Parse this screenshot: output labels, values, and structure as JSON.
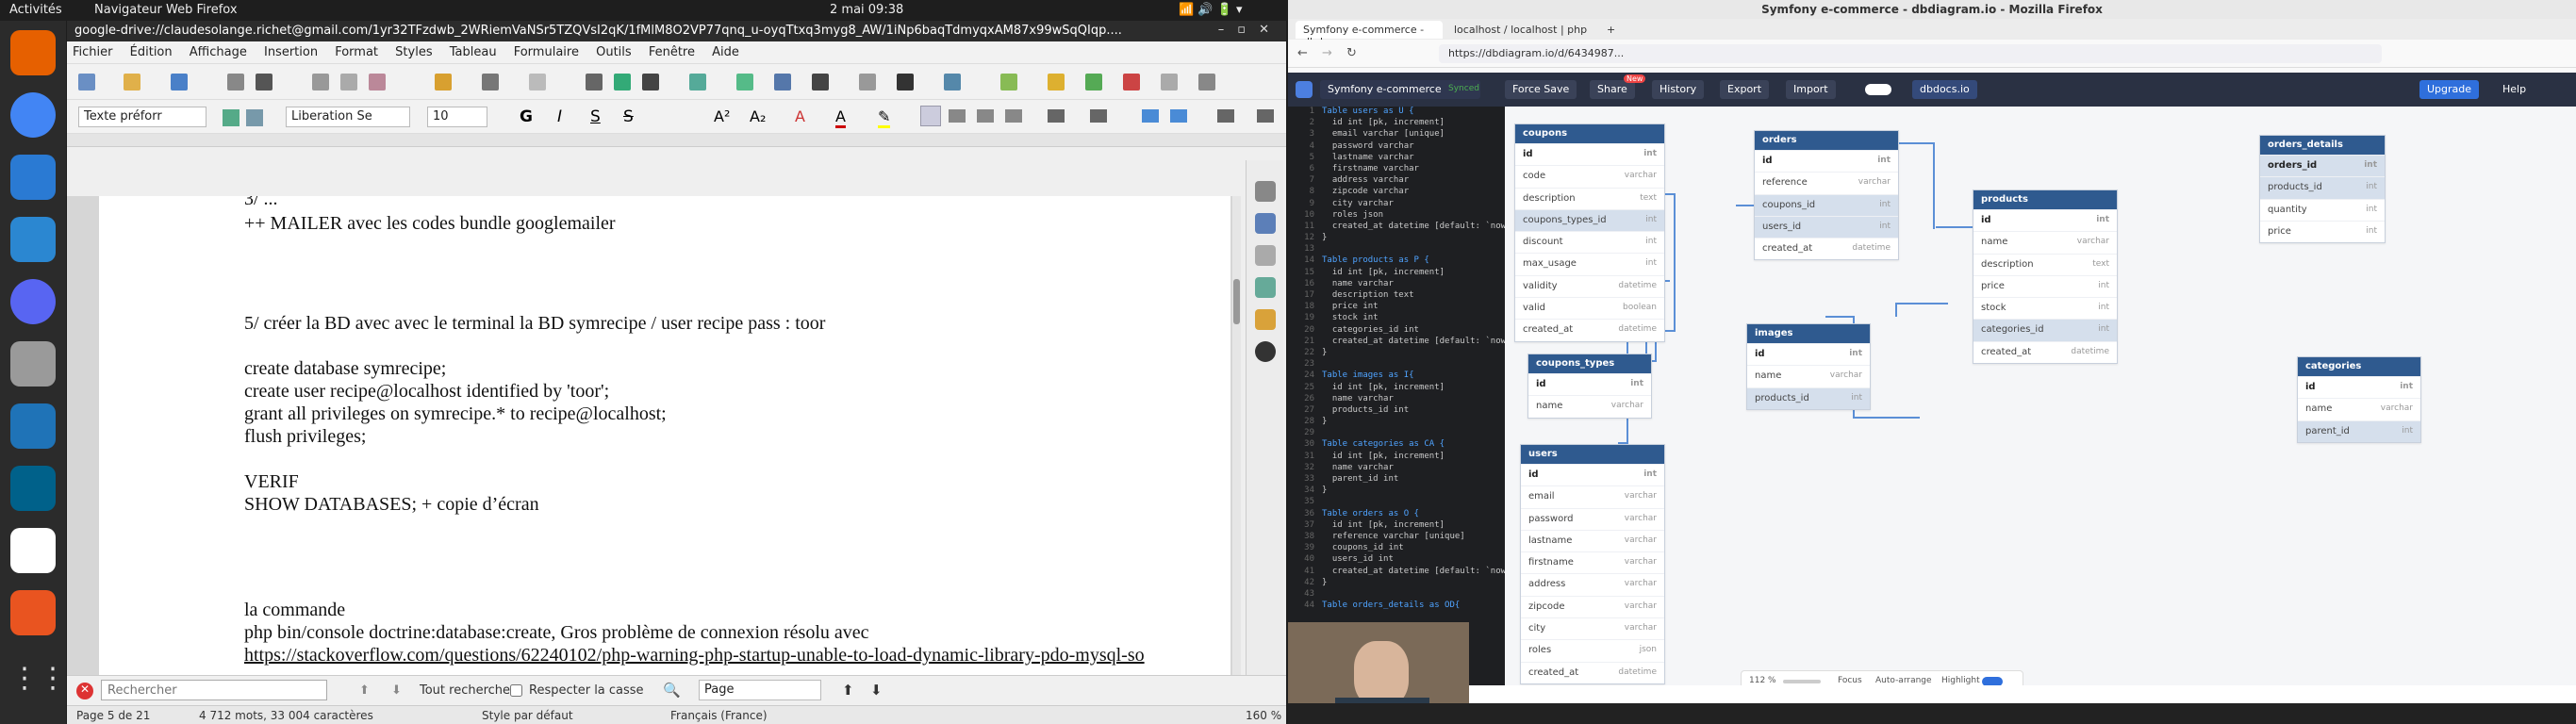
{
  "system": {
    "activities": "Activités",
    "app_menu": "Navigateur Web Firefox",
    "clock": "2 mai  09:38"
  },
  "writer": {
    "title": "google-drive://claudesolange.richet@gmail.com/1yr32TFzdwb_2WRiemVaNSr5TZQVsI2qK/1fMlM8O2VP77qnq_u-oyqTtxq3myg8_AW/1iNp6baqTdmyqxAM87x99wSqQIqp....",
    "menu": [
      "Fichier",
      "Édition",
      "Affichage",
      "Insertion",
      "Format",
      "Styles",
      "Tableau",
      "Formulaire",
      "Outils",
      "Fenêtre",
      "Aide"
    ],
    "para_style": "Texte préforr",
    "font_name": "Liberation Se",
    "font_size": "10",
    "lines": [
      {
        "text": "3/ ..."
      },
      {
        "text": "++ MAILER avec les codes   bundle googlemailer"
      },
      {
        "text": "5/ créer la BD avec avec le terminal la BD symrecipe / user recipe pass : toor"
      },
      {
        "text": "create database symrecipe;"
      },
      {
        "text": "create user recipe@localhost identified by 'toor';"
      },
      {
        "text": "grant all privileges on symrecipe.* to recipe@localhost;"
      },
      {
        "text": "flush privileges;"
      },
      {
        "text": "VERIF"
      },
      {
        "text": "SHOW DATABASES; + copie d’écran"
      },
      {
        "text": " la commande"
      },
      {
        "text": " php bin/console doctrine:database:create, Gros problème de connexion résolu avec"
      },
      {
        "text": "https://stackoverflow.com/questions/62240102/php-warning-php-startup-unable-to-load-dynamic-library-pdo-mysql-so"
      }
    ],
    "find": {
      "placeholder": "Rechercher",
      "find_all": "Tout rechercher",
      "match_case": "Respecter la casse",
      "scope": "Page"
    },
    "status": {
      "page": "Page 5 de 21",
      "words": "4 712 mots, 33 004 caractères",
      "style": "Style par défaut",
      "lang": "Français (France)",
      "zoom": "160 %"
    }
  },
  "firefox": {
    "window_title": "Symfony e-commerce - dbdiagram.io - Mozilla Firefox",
    "tabs": [
      "Symfony e-commerce - dbd",
      "localhost / localhost | php"
    ],
    "url": "https://dbdiagram.io/d/6434987...",
    "db": {
      "project": "Symfony e-commerce",
      "synced": "Synced",
      "buttons": [
        "Force Save",
        "Share",
        "History",
        "Export",
        "Import"
      ],
      "new_badge": "New",
      "dbdocs": "dbdocs.io",
      "upgrade": "Upgrade",
      "help": "Help",
      "zoom": "112 %",
      "focus": "Focus",
      "auto_arrange": "Auto-arrange",
      "highlight": "Highlight"
    },
    "code": [
      "Table users as U {",
      "  id int [pk, increment]",
      "  email varchar [unique]",
      "  password varchar",
      "  lastname varchar",
      "  firstname varchar",
      "  address varchar",
      "  zipcode varchar",
      "  city varchar",
      "  roles json",
      "  created_at datetime [default: `now",
      "}",
      "",
      "Table products as P {",
      "  id int [pk, increment]",
      "  name varchar",
      "  description text",
      "  price int",
      "  stock int",
      "  categories_id int",
      "  created_at datetime [default: `now",
      "}",
      "",
      "Table images as I{",
      "  id int [pk, increment]",
      "  name varchar",
      "  products_id int",
      "}",
      "",
      "Table categories as CA {",
      "  id int [pk, increment]",
      "  name varchar",
      "  parent_id int",
      "}",
      "",
      "Table orders as O {",
      "  id int [pk, increment]",
      "  reference varchar [unique]",
      "  coupons_id int",
      "  users_id int",
      "  created_at datetime [default: `now",
      "}",
      "",
      "Table orders_details as OD{"
    ],
    "tables": {
      "coupons": {
        "name": "coupons",
        "fields": [
          [
            "id",
            "int"
          ],
          [
            "code",
            "varchar"
          ],
          [
            "description",
            "text"
          ],
          [
            "coupons_types_id",
            "int"
          ],
          [
            "discount",
            "int"
          ],
          [
            "max_usage",
            "int"
          ],
          [
            "validity",
            "datetime"
          ],
          [
            "valid",
            "boolean"
          ],
          [
            "created_at",
            "datetime"
          ]
        ]
      },
      "coupons_types": {
        "name": "coupons_types",
        "fields": [
          [
            "id",
            "int"
          ],
          [
            "name",
            "varchar"
          ]
        ]
      },
      "users": {
        "name": "users",
        "fields": [
          [
            "id",
            "int"
          ],
          [
            "email",
            "varchar"
          ],
          [
            "password",
            "varchar"
          ],
          [
            "lastname",
            "varchar"
          ],
          [
            "firstname",
            "varchar"
          ],
          [
            "address",
            "varchar"
          ],
          [
            "zipcode",
            "varchar"
          ],
          [
            "city",
            "varchar"
          ],
          [
            "roles",
            "json"
          ],
          [
            "created_at",
            "datetime"
          ]
        ]
      },
      "orders": {
        "name": "orders",
        "fields": [
          [
            "id",
            "int"
          ],
          [
            "reference",
            "varchar"
          ],
          [
            "coupons_id",
            "int"
          ],
          [
            "users_id",
            "int"
          ],
          [
            "created_at",
            "datetime"
          ]
        ]
      },
      "images": {
        "name": "images",
        "fields": [
          [
            "id",
            "int"
          ],
          [
            "name",
            "varchar"
          ],
          [
            "products_id",
            "int"
          ]
        ]
      },
      "products": {
        "name": "products",
        "fields": [
          [
            "id",
            "int"
          ],
          [
            "name",
            "varchar"
          ],
          [
            "description",
            "text"
          ],
          [
            "price",
            "int"
          ],
          [
            "stock",
            "int"
          ],
          [
            "categories_id",
            "int"
          ],
          [
            "created_at",
            "datetime"
          ]
        ]
      },
      "orders_details": {
        "name": "orders_details",
        "fields": [
          [
            "orders_id",
            "int"
          ],
          [
            "products_id",
            "int"
          ],
          [
            "quantity",
            "int"
          ],
          [
            "price",
            "int"
          ]
        ]
      },
      "categories": {
        "name": "categories",
        "fields": [
          [
            "id",
            "int"
          ],
          [
            "name",
            "varchar"
          ],
          [
            "parent_id",
            "int"
          ]
        ]
      }
    }
  }
}
